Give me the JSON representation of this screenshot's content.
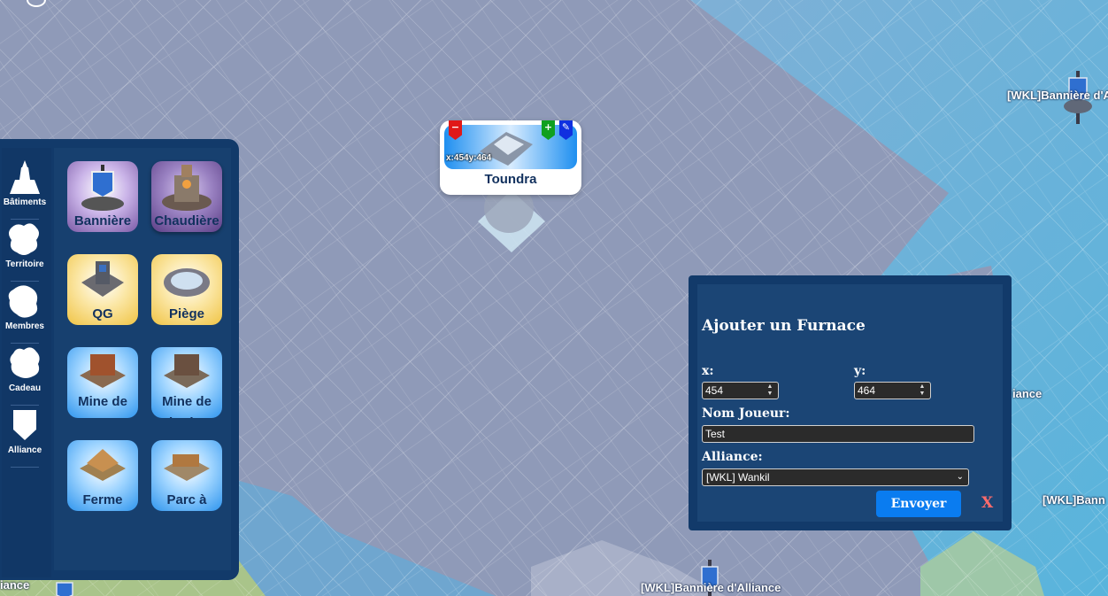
{
  "map": {
    "labels": [
      "[WKL]Bannière d'A",
      "iance",
      "[WKL]Bann",
      "[WKL]Bannière d'Alliance",
      "iance"
    ]
  },
  "sidebar": {
    "categories": [
      {
        "label": "Bâtiments",
        "icon": "tower-icon"
      },
      {
        "label": "Territoire",
        "icon": "flag-icon"
      },
      {
        "label": "Membres",
        "icon": "people-icon"
      },
      {
        "label": "Cadeau",
        "icon": "gift-icon"
      },
      {
        "label": "Alliance",
        "icon": "shield-icon"
      }
    ],
    "tiles": [
      {
        "label": "Bannière",
        "icon": "banner-icon",
        "style": "purple"
      },
      {
        "label": "Chaudière",
        "icon": "furnace-icon",
        "style": "purple-selected"
      },
      {
        "label": "QG",
        "icon": "headquarters-icon",
        "style": "gold"
      },
      {
        "label": "Piège",
        "icon": "trap-icon",
        "style": "gold"
      },
      {
        "label": "Mine de Fer",
        "icon": "iron-mine-icon",
        "style": "blue"
      },
      {
        "label": "Mine de Charbon",
        "icon": "coal-mine-icon",
        "style": "blue"
      },
      {
        "label": "Ferme",
        "icon": "farm-icon",
        "style": "blue"
      },
      {
        "label": "Parc à Bois",
        "icon": "lumber-yard-icon",
        "style": "blue"
      }
    ]
  },
  "tile_popup": {
    "coords": "x:454y:464",
    "title": "Toundra",
    "remove_symbol": "−",
    "add_symbol": "+",
    "edit_symbol": "✎"
  },
  "dialog": {
    "title": "Ajouter un Furnace",
    "x_label": "x:",
    "x_value": "454",
    "y_label": "y:",
    "y_value": "464",
    "player_label": "Nom Joueur:",
    "player_value": "Test",
    "alliance_label": "Alliance:",
    "alliance_value": "[WKL] Wankil",
    "submit_label": "Envoyer",
    "close_label": "X"
  },
  "colors": {
    "panel": "#123a6a",
    "submit": "#0a7cf0",
    "close": "#ff6b6b"
  }
}
